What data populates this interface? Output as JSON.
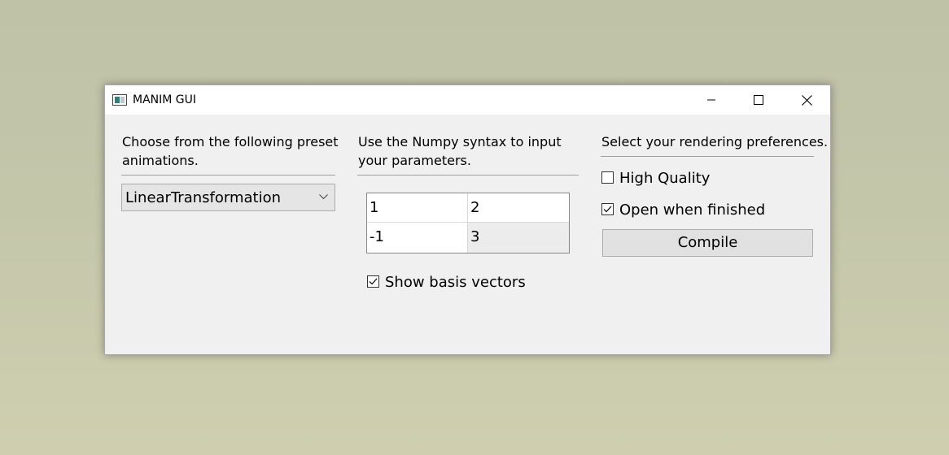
{
  "window": {
    "title": "MANIM GUI"
  },
  "presets": {
    "label_line1": "Choose from the following preset",
    "label_line2": "animations.",
    "selected": "LinearTransformation"
  },
  "parameters": {
    "label_line1": "Use the Numpy syntax to input",
    "label_line2": "your parameters.",
    "matrix": [
      [
        "1",
        "2"
      ],
      [
        "-1",
        "3"
      ]
    ],
    "show_basis_vectors": {
      "label": "Show basis vectors",
      "checked": true
    }
  },
  "rendering": {
    "label": "Select your rendering preferences.",
    "high_quality": {
      "label": "High Quality",
      "checked": false
    },
    "open_when_finished": {
      "label": "Open when finished",
      "checked": true
    },
    "compile_label": "Compile"
  },
  "icons": {
    "app": "app-icon",
    "minimize": "minimize-icon",
    "maximize": "maximize-icon",
    "close": "close-icon",
    "dropdown": "chevron-down-icon",
    "check": "checkmark-icon"
  }
}
